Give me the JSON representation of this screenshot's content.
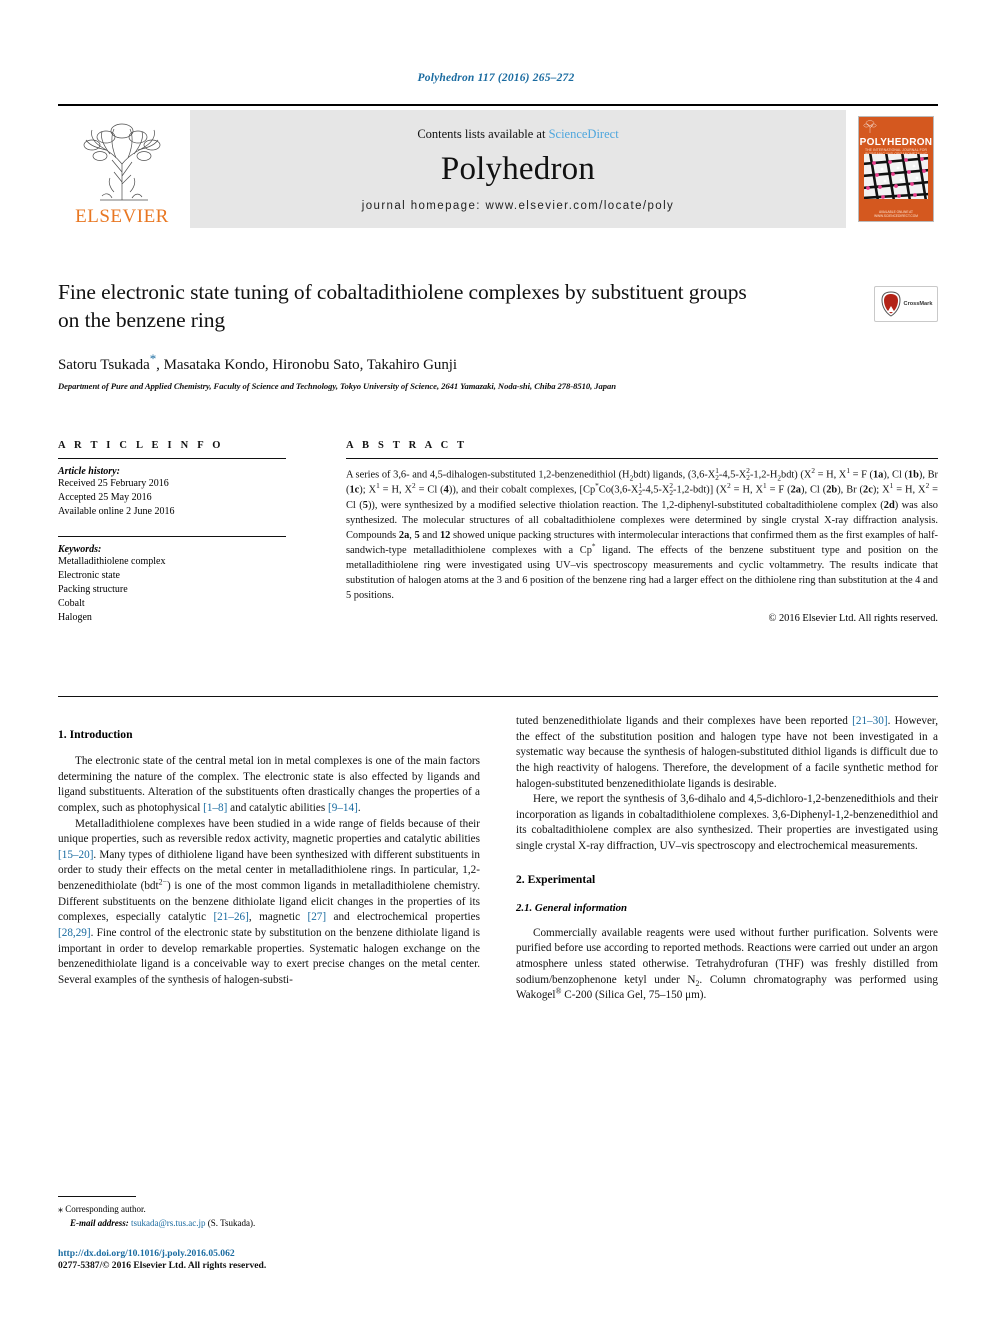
{
  "running_head": "Polyhedron 117 (2016) 265–272",
  "masthead": {
    "publisher": "ELSEVIER",
    "contents_prefix": "Contents lists available at",
    "sciencedirect": "ScienceDirect",
    "journal_title": "Polyhedron",
    "homepage": "journal homepage: www.elsevier.com/locate/poly",
    "cover_title": "POLYHEDRON",
    "cover_subtitle": "THE INTERNATIONAL JOURNAL FOR INORGANIC AND ORGANOMETALLIC CHEMISTRY",
    "cover_footer": "AVAILABLE ONLINE AT WWW.SCIENCEDIRECT.COM",
    "accent_orange": "#e87722",
    "link_blue": "#1a6ba0",
    "banner_gray": "#e6e6e6"
  },
  "article": {
    "title": "Fine electronic state tuning of cobaltadithiolene complexes by substituent groups on the benzene ring",
    "authors": "Satoru Tsukada",
    "authors_rest": ", Masataka Kondo, Hironobu Sato, Takahiro Gunji",
    "corresponding_mark": "*",
    "affiliation": "Department of Pure and Applied Chemistry, Faculty of Science and Technology, Tokyo University of Science, 2641 Yamazaki, Noda-shi, Chiba 278-8510, Japan",
    "crossmark_label": "CrossMark"
  },
  "info": {
    "heading": "A R T I C L E   I N F O",
    "history_label": "Article history:",
    "history": [
      "Received 25 February 2016",
      "Accepted 25 May 2016",
      "Available online 2 June 2016"
    ],
    "keywords_label": "Keywords:",
    "keywords": [
      "Metalladithiolene complex",
      "Electronic state",
      "Packing structure",
      "Cobalt",
      "Halogen"
    ]
  },
  "abstract": {
    "heading": "A B S T R A C T",
    "copyright": "© 2016 Elsevier Ltd. All rights reserved."
  },
  "sections": {
    "intro_heading": "1. Introduction",
    "intro_p1_a": "The electronic state of the central metal ion in metal complexes is one of the main factors determining the nature of the complex. The electronic state is also effected by ligands and ligand substituents. Alteration of the substituents often drastically changes the properties of a complex, such as photophysical ",
    "intro_p1_cite1": "[1–8]",
    "intro_p1_b": " and catalytic abilities ",
    "intro_p1_cite2": "[9–14]",
    "intro_p1_c": ".",
    "intro_p2_a": "Metalladithiolene complexes have been studied in a wide range of fields because of their unique properties, such as reversible redox activity, magnetic properties and catalytic abilities ",
    "intro_p2_cite1": "[15–20]",
    "intro_p2_b": ". Many types of dithiolene ligand have been synthesized with different substituents in order to study their effects on the metal center in metalladithiolene rings. In particular, 1,2-benzenedithiolate (bdt",
    "intro_p2_sup": "2−",
    "intro_p2_c": ") is one of the most common ligands in metalladithiolene chemistry. Different substituents on the benzene dithiolate ligand elicit changes in the properties of its complexes, especially catalytic ",
    "intro_p2_cite2": "[21–26]",
    "intro_p2_d": ", magnetic ",
    "intro_p2_cite3": "[27]",
    "intro_p2_e": " and electrochemical properties ",
    "intro_p2_cite4": "[28,29]",
    "intro_p2_f": ". Fine control of the electronic state by substitution on the benzene dithiolate ligand is important in order to develop remarkable properties. Systematic halogen exchange on the benzenedithiolate ligand is a conceivable way to exert precise changes on the metal center. Several examples of the synthesis of halogen-substi-",
    "intro_p3_a": "tuted benzenedithiolate ligands and their complexes have been reported ",
    "intro_p3_cite1": "[21–30]",
    "intro_p3_b": ". However, the effect of the substitution position and halogen type have not been investigated in a systematic way because the synthesis of halogen-substituted dithiol ligands is difficult due to the high reactivity of halogens. Therefore, the development of a facile synthetic method for halogen-substituted benzenedithiolate ligands is desirable.",
    "intro_p4": "Here, we report the synthesis of 3,6-dihalo and 4,5-dichloro-1,2-benzenedithiols and their incorporation as ligands in cobaltadithiolene complexes. 3,6-Diphenyl-1,2-benzenedithiol and its cobaltadithiolene complex are also synthesized. Their properties are investigated using single crystal X-ray diffraction, UV–vis spectroscopy and electrochemical measurements.",
    "exp_heading": "2. Experimental",
    "exp_sub_heading": "2.1. General information",
    "exp_p1_a": "Commercially available reagents were used without further purification. Solvents were purified before use according to reported methods. Reactions were carried out under an argon atmosphere unless stated otherwise. Tetrahydrofuran (THF) was freshly distilled from sodium/benzophenone ketyl under N",
    "exp_p1_sub": "2",
    "exp_p1_b": ". Column chromatography was performed using Wakogel",
    "exp_p1_reg": "®",
    "exp_p1_c": " C-200 (Silica Gel, 75–150 μm)."
  },
  "footnote": {
    "star": "⁎",
    "corresponding": "Corresponding author.",
    "email_label": "E-mail address:",
    "email": "tsukada@rs.tus.ac.jp",
    "email_owner": "(S. Tsukada)."
  },
  "doc_footer": {
    "doi": "http://dx.doi.org/10.1016/j.poly.2016.05.062",
    "issn": "0277-5387/© 2016 Elsevier Ltd. All rights reserved."
  }
}
